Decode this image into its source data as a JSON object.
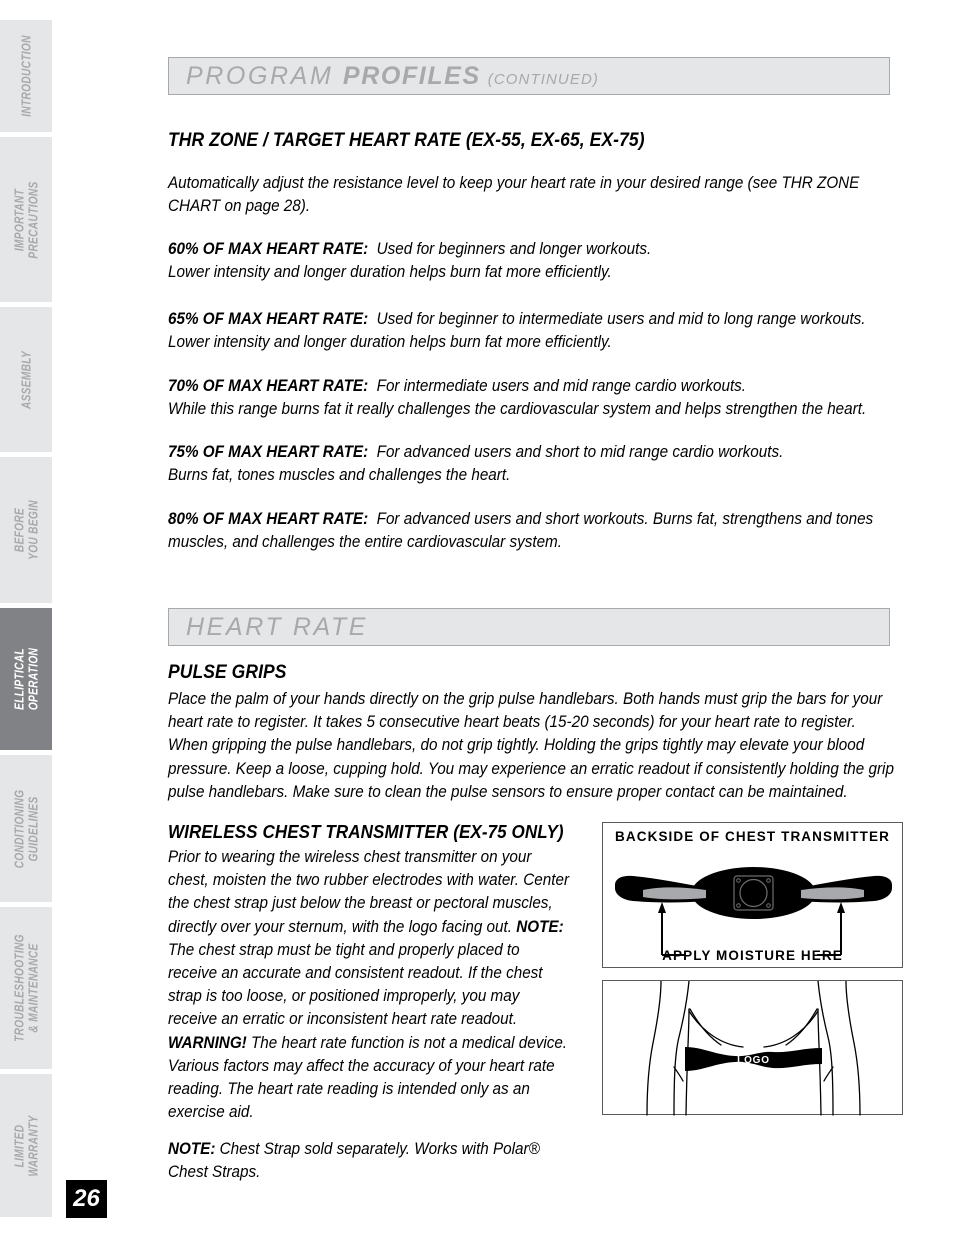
{
  "sidebar": {
    "tabs": [
      {
        "label": "INTRODUCTION",
        "active": false,
        "lines": [
          "INTRODUCTION"
        ]
      },
      {
        "label": "IMPORTANT PRECAUTIONS",
        "active": false,
        "lines": [
          "IMPORTANT",
          "PRECAUTIONS"
        ]
      },
      {
        "label": "ASSEMBLY",
        "active": false,
        "lines": [
          "ASSEMBLY"
        ]
      },
      {
        "label": "BEFORE YOU BEGIN",
        "active": false,
        "lines": [
          "BEFORE",
          "YOU BEGIN"
        ]
      },
      {
        "label": "ELLIPTICAL OPERATION",
        "active": true,
        "lines": [
          "ELLIPTICAL",
          "OPERATION"
        ]
      },
      {
        "label": "CONDITIONING GUIDELINES",
        "active": false,
        "lines": [
          "CONDITIONING",
          "GUIDELINES"
        ]
      },
      {
        "label": "TROUBLESHOOTING & MAINTENANCE",
        "active": false,
        "lines": [
          "TROUBLESHOOTING",
          "& MAINTENANCE"
        ]
      },
      {
        "label": "LIMITED WARRANTY",
        "active": false,
        "lines": [
          "LIMITED",
          "WARRANTY"
        ]
      }
    ]
  },
  "page_number": "26",
  "header": {
    "title_light": "PROGRAM",
    "title_bold": "PROFILES",
    "title_continued": "(CONTINUED)"
  },
  "thr": {
    "heading": "THR ZONE / TARGET HEART RATE (EX-55, EX-65, EX-75)",
    "intro": "Automatically adjust the resistance level to keep your heart rate in your desired range (see THR ZONE CHART on page 28).",
    "zones": [
      {
        "label": "60% OF MAX HEART RATE:",
        "line1": "Used for beginners and longer workouts.",
        "line2": "Lower intensity and longer duration helps burn fat more efficiently."
      },
      {
        "label": "65% OF MAX HEART RATE:",
        "line1": "Used for beginner to intermediate users and mid to long range workouts.",
        "line2": "Lower intensity and longer duration helps burn fat more efficiently."
      },
      {
        "label": "70% OF MAX HEART RATE:",
        "line1": "For intermediate users and mid range cardio workouts.",
        "line2": "While this range burns fat it really challenges the cardiovascular system and helps strengthen the heart."
      },
      {
        "label": "75% OF MAX HEART RATE:",
        "line1": "For advanced users and short to mid range cardio workouts.",
        "line2": "Burns fat, tones muscles and challenges the heart."
      },
      {
        "label": "80% OF MAX HEART RATE:",
        "line1": "For advanced users and short workouts.  Burns fat, strengthens and tones",
        "line2": "muscles, and challenges the entire cardiovascular system."
      }
    ]
  },
  "heart_rate": {
    "section_title": "HEART RATE",
    "pulse_grips": {
      "heading": "PULSE GRIPS",
      "body": "Place the palm of your hands directly on the grip pulse handlebars. Both hands must grip the bars for your heart rate to register. It takes 5 consecutive heart beats (15-20 seconds) for your heart rate to register. When gripping the pulse handlebars, do not grip tightly. Holding the grips tightly may elevate your blood pressure. Keep a loose, cupping hold. You may experience an erratic readout if consistently holding the grip pulse handlebars. Make sure to clean the pulse sensors to ensure proper contact can be maintained."
    },
    "transmitter": {
      "heading": "WIRELESS CHEST TRANSMITTER (EX-75 ONLY)",
      "para1_a": "Prior to wearing the wireless chest transmitter on your chest, moisten the two rubber electrodes with water. Center the chest strap just below the breast or pectoral muscles, directly over your sternum, with the logo facing out. ",
      "para1_note_label": "NOTE:",
      "para1_b": " The chest strap must be tight and properly placed to receive an accurate and consistent readout. If the chest strap is too loose, or positioned improperly, you may receive an erratic or inconsistent heart rate readout. ",
      "para1_warning_label": "WARNING!",
      "para1_c": " The heart rate function is not a medical device. Various factors may affect the accuracy of your heart rate reading. The heart rate reading is intended only as an exercise aid.",
      "note_label": "NOTE:",
      "note_text": " Chest Strap sold separately. Works with Polar® Chest Straps."
    }
  },
  "figures": {
    "transmitter_back": {
      "caption_top": "BACKSIDE OF CHEST TRANSMITTER",
      "caption_bottom": "APPLY MOISTURE HERE"
    },
    "torso": {
      "strap_label": "LOGO"
    }
  },
  "colors": {
    "bar_fill": "#e4e6e7",
    "bar_border": "#a7a9ac",
    "bar_text": "#a7a9ac",
    "tab_inactive": "#e4e6e7",
    "tab_active": "#808285",
    "tab_inactive_text": "#a7a9ac",
    "tab_active_text": "#ffffff",
    "page_badge_bg": "#000000",
    "ink": "#000000"
  }
}
